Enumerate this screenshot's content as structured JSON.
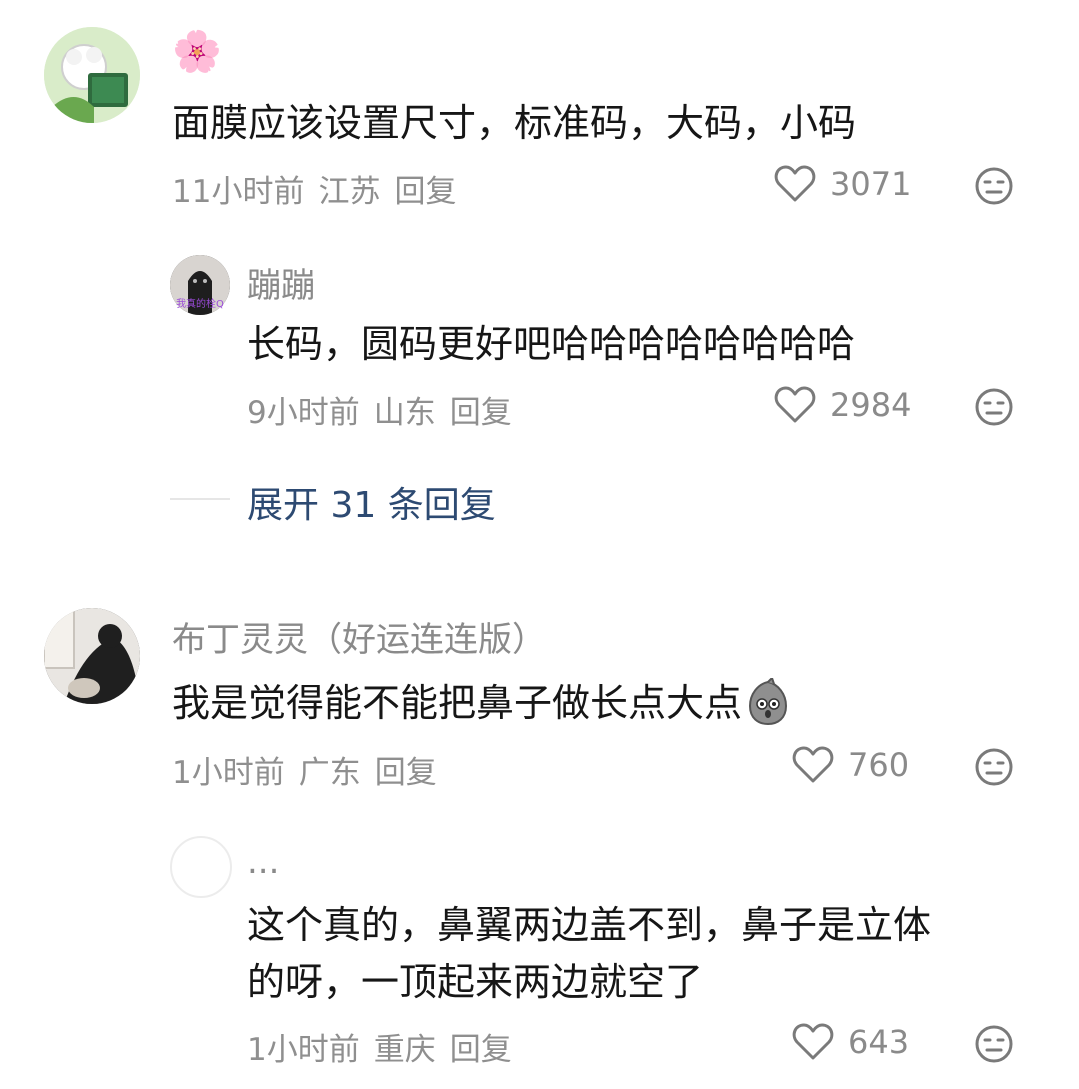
{
  "comments": [
    {
      "name": "🌸",
      "text": "面膜应该设置尺寸，标准码，大码，小码",
      "time": "11小时前",
      "location": "江苏",
      "reply_label": "回复",
      "likes": "3071"
    },
    {
      "name": "蹦蹦",
      "avatar_caption": "我真的栓Q",
      "text": "长码，圆码更好吧哈哈哈哈哈哈哈哈",
      "time": "9小时前",
      "location": "山东",
      "reply_label": "回复",
      "likes": "2984"
    },
    {
      "name": "布丁灵灵（好运连连版）",
      "text": "我是觉得能不能把鼻子做长点大点",
      "time": "1小时前",
      "location": "广东",
      "reply_label": "回复",
      "likes": "760"
    },
    {
      "name": "...",
      "text_line1": "这个真的，鼻翼两边盖不到，鼻子是立体",
      "text_line2": "的呀，一顶起来两边就空了",
      "time": "1小时前",
      "location": "重庆",
      "reply_label": "回复",
      "likes": "643"
    }
  ],
  "expand_replies": "展开 31 条回复",
  "colors": {
    "text": "#161616",
    "meta": "#8f8f8f",
    "expand": "#2d4a72"
  },
  "icons": [
    "heart-outline-icon",
    "meh-face-icon",
    "sticker-emoji-icon"
  ]
}
